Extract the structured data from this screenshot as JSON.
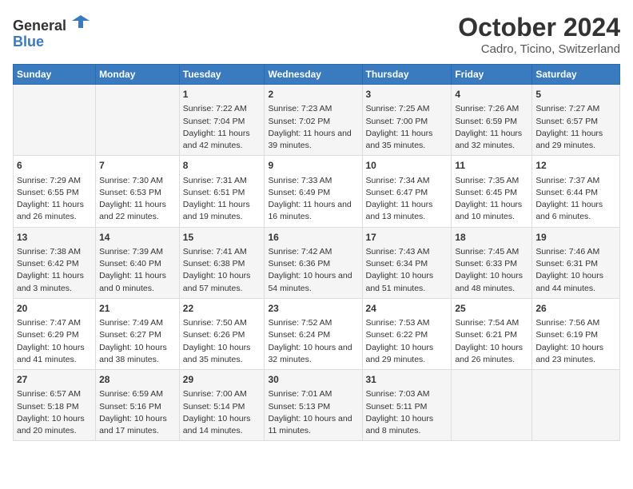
{
  "header": {
    "logo_general": "General",
    "logo_blue": "Blue",
    "title": "October 2024",
    "subtitle": "Cadro, Ticino, Switzerland"
  },
  "days_of_week": [
    "Sunday",
    "Monday",
    "Tuesday",
    "Wednesday",
    "Thursday",
    "Friday",
    "Saturday"
  ],
  "weeks": [
    [
      {
        "day": "",
        "content": ""
      },
      {
        "day": "",
        "content": ""
      },
      {
        "day": "1",
        "content": "Sunrise: 7:22 AM\nSunset: 7:04 PM\nDaylight: 11 hours and 42 minutes."
      },
      {
        "day": "2",
        "content": "Sunrise: 7:23 AM\nSunset: 7:02 PM\nDaylight: 11 hours and 39 minutes."
      },
      {
        "day": "3",
        "content": "Sunrise: 7:25 AM\nSunset: 7:00 PM\nDaylight: 11 hours and 35 minutes."
      },
      {
        "day": "4",
        "content": "Sunrise: 7:26 AM\nSunset: 6:59 PM\nDaylight: 11 hours and 32 minutes."
      },
      {
        "day": "5",
        "content": "Sunrise: 7:27 AM\nSunset: 6:57 PM\nDaylight: 11 hours and 29 minutes."
      }
    ],
    [
      {
        "day": "6",
        "content": "Sunrise: 7:29 AM\nSunset: 6:55 PM\nDaylight: 11 hours and 26 minutes."
      },
      {
        "day": "7",
        "content": "Sunrise: 7:30 AM\nSunset: 6:53 PM\nDaylight: 11 hours and 22 minutes."
      },
      {
        "day": "8",
        "content": "Sunrise: 7:31 AM\nSunset: 6:51 PM\nDaylight: 11 hours and 19 minutes."
      },
      {
        "day": "9",
        "content": "Sunrise: 7:33 AM\nSunset: 6:49 PM\nDaylight: 11 hours and 16 minutes."
      },
      {
        "day": "10",
        "content": "Sunrise: 7:34 AM\nSunset: 6:47 PM\nDaylight: 11 hours and 13 minutes."
      },
      {
        "day": "11",
        "content": "Sunrise: 7:35 AM\nSunset: 6:45 PM\nDaylight: 11 hours and 10 minutes."
      },
      {
        "day": "12",
        "content": "Sunrise: 7:37 AM\nSunset: 6:44 PM\nDaylight: 11 hours and 6 minutes."
      }
    ],
    [
      {
        "day": "13",
        "content": "Sunrise: 7:38 AM\nSunset: 6:42 PM\nDaylight: 11 hours and 3 minutes."
      },
      {
        "day": "14",
        "content": "Sunrise: 7:39 AM\nSunset: 6:40 PM\nDaylight: 11 hours and 0 minutes."
      },
      {
        "day": "15",
        "content": "Sunrise: 7:41 AM\nSunset: 6:38 PM\nDaylight: 10 hours and 57 minutes."
      },
      {
        "day": "16",
        "content": "Sunrise: 7:42 AM\nSunset: 6:36 PM\nDaylight: 10 hours and 54 minutes."
      },
      {
        "day": "17",
        "content": "Sunrise: 7:43 AM\nSunset: 6:34 PM\nDaylight: 10 hours and 51 minutes."
      },
      {
        "day": "18",
        "content": "Sunrise: 7:45 AM\nSunset: 6:33 PM\nDaylight: 10 hours and 48 minutes."
      },
      {
        "day": "19",
        "content": "Sunrise: 7:46 AM\nSunset: 6:31 PM\nDaylight: 10 hours and 44 minutes."
      }
    ],
    [
      {
        "day": "20",
        "content": "Sunrise: 7:47 AM\nSunset: 6:29 PM\nDaylight: 10 hours and 41 minutes."
      },
      {
        "day": "21",
        "content": "Sunrise: 7:49 AM\nSunset: 6:27 PM\nDaylight: 10 hours and 38 minutes."
      },
      {
        "day": "22",
        "content": "Sunrise: 7:50 AM\nSunset: 6:26 PM\nDaylight: 10 hours and 35 minutes."
      },
      {
        "day": "23",
        "content": "Sunrise: 7:52 AM\nSunset: 6:24 PM\nDaylight: 10 hours and 32 minutes."
      },
      {
        "day": "24",
        "content": "Sunrise: 7:53 AM\nSunset: 6:22 PM\nDaylight: 10 hours and 29 minutes."
      },
      {
        "day": "25",
        "content": "Sunrise: 7:54 AM\nSunset: 6:21 PM\nDaylight: 10 hours and 26 minutes."
      },
      {
        "day": "26",
        "content": "Sunrise: 7:56 AM\nSunset: 6:19 PM\nDaylight: 10 hours and 23 minutes."
      }
    ],
    [
      {
        "day": "27",
        "content": "Sunrise: 6:57 AM\nSunset: 5:18 PM\nDaylight: 10 hours and 20 minutes."
      },
      {
        "day": "28",
        "content": "Sunrise: 6:59 AM\nSunset: 5:16 PM\nDaylight: 10 hours and 17 minutes."
      },
      {
        "day": "29",
        "content": "Sunrise: 7:00 AM\nSunset: 5:14 PM\nDaylight: 10 hours and 14 minutes."
      },
      {
        "day": "30",
        "content": "Sunrise: 7:01 AM\nSunset: 5:13 PM\nDaylight: 10 hours and 11 minutes."
      },
      {
        "day": "31",
        "content": "Sunrise: 7:03 AM\nSunset: 5:11 PM\nDaylight: 10 hours and 8 minutes."
      },
      {
        "day": "",
        "content": ""
      },
      {
        "day": "",
        "content": ""
      }
    ]
  ]
}
